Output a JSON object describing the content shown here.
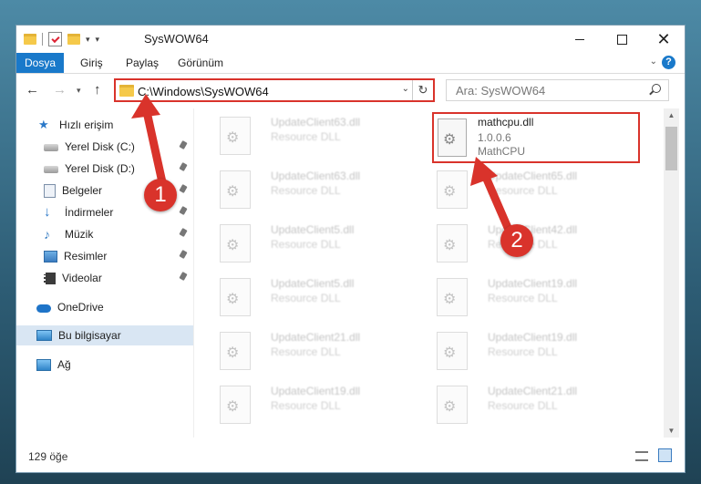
{
  "window": {
    "title": "SysWOW64"
  },
  "ribbon": {
    "tabs": [
      "Dosya",
      "Giriş",
      "Paylaş",
      "Görünüm"
    ]
  },
  "navigation": {
    "address": "C:\\Windows\\SysWOW64",
    "search_placeholder": "Ara: SysWOW64"
  },
  "sidebar": {
    "items": [
      {
        "label": "Hızlı erişim",
        "icon": "star-icon"
      },
      {
        "label": "Yerel Disk (C:)",
        "icon": "disk-icon"
      },
      {
        "label": "Yerel Disk (D:)",
        "icon": "disk-icon"
      },
      {
        "label": "Belgeler",
        "icon": "documents-icon"
      },
      {
        "label": "İndirmeler",
        "icon": "download-icon"
      },
      {
        "label": "Müzik",
        "icon": "music-icon"
      },
      {
        "label": "Resimler",
        "icon": "pictures-icon"
      },
      {
        "label": "Videolar",
        "icon": "videos-icon"
      },
      {
        "label": "OneDrive",
        "icon": "cloud-icon"
      },
      {
        "label": "Bu bilgisayar",
        "icon": "computer-icon"
      },
      {
        "label": "Ağ",
        "icon": "network-icon"
      }
    ]
  },
  "files": {
    "highlighted": {
      "name": "mathcpu.dll",
      "version": "1.0.0.6",
      "description": "MathCPU"
    },
    "left_column": [
      {
        "name": "UpdateClient63.dll",
        "desc": "Resource DLL"
      },
      {
        "name": "UpdateClient63.dll",
        "desc": "Resource DLL"
      },
      {
        "name": "UpdateClient5.dll",
        "desc": "Resource DLL"
      },
      {
        "name": "UpdateClient5.dll",
        "desc": "Resource DLL"
      },
      {
        "name": "UpdateClient21.dll",
        "desc": "Resource DLL"
      },
      {
        "name": "UpdateClient19.dll",
        "desc": "Resource DLL"
      }
    ],
    "right_column": [
      {
        "name": "UpdateClient65.dll",
        "desc": "Resource DLL"
      },
      {
        "name": "UpdateClient42.dll",
        "desc": "Resource DLL"
      },
      {
        "name": "UpdateClient19.dll",
        "desc": "Resource DLL"
      },
      {
        "name": "UpdateClient19.dll",
        "desc": "Resource DLL"
      },
      {
        "name": "UpdateClient21.dll",
        "desc": "Resource DLL"
      }
    ]
  },
  "status": {
    "item_count": "129 öğe"
  },
  "annotations": {
    "badge1": "1",
    "badge2": "2",
    "color": "#d9332b"
  }
}
